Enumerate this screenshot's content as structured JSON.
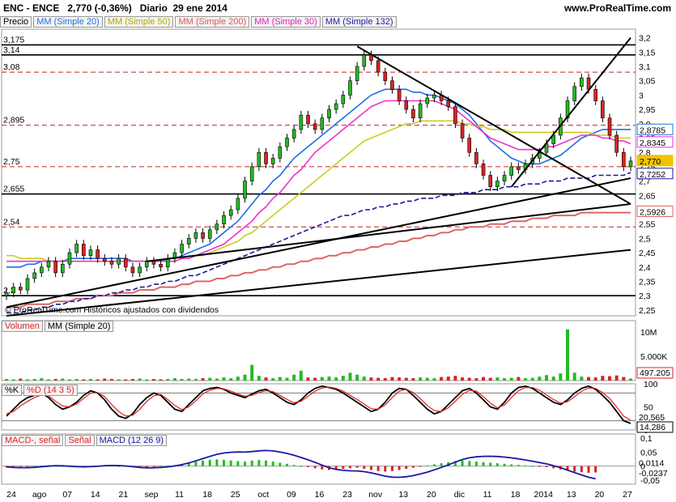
{
  "header": {
    "ticker": "ENC - ENCE",
    "last": "2,770 (-0,36%)",
    "period": "Diario",
    "date": "29 ene 2014",
    "brand": "www.ProRealTime.com"
  },
  "price_legend": {
    "price": "Precio",
    "mm20": "MM (Simple 20)",
    "mm50": "MM (Simple 50)",
    "mm200": "MM (Simple 200)",
    "mm30": "MM (Simple 30)",
    "mm132": "MM (Simple 132)"
  },
  "watermark": "© ProRealTime.com  Históricos ajustados con dividendos",
  "volume_legend": {
    "volume": "Volumen",
    "mm": "MM (Simple 20)"
  },
  "stoch_legend": {
    "k": "%K",
    "d": "%D (14 3 5)"
  },
  "macd_legend": {
    "macd": "MACD-, señal",
    "signal": "Señal",
    "params": "MACD (12 26 9)"
  },
  "colors": {
    "up": "#22bb22",
    "down": "#dd2222",
    "mm20": "#1f6fe0",
    "mm50": "#cccc22",
    "mm200": "#dd6666",
    "mm30": "#ee33cc",
    "mm132": "#1a1aa0",
    "current_label_bg": "#f2c200"
  },
  "chart_data": [
    {
      "type": "candlestick",
      "title": "ENC - ENCE",
      "ylim": [
        2.23,
        3.23
      ],
      "y_ticks": [
        "3,2",
        "3,15",
        "3,1",
        "3,05",
        "3",
        "2,95",
        "2,9",
        "2,85",
        "2,8",
        "2,75",
        "2,7",
        "2,65",
        "2,6",
        "2,55",
        "2,5",
        "2,45",
        "2,4",
        "2,35",
        "2,3",
        "2,25"
      ],
      "x_ticks": [
        "24",
        "ago",
        "07",
        "14",
        "21",
        "sep",
        "11",
        "18",
        "25",
        "oct",
        "09",
        "16",
        "23",
        "nov",
        "13",
        "20",
        "dic",
        "11",
        "18",
        "2014",
        "13",
        "20",
        "27"
      ],
      "horizontal_levels": [
        {
          "label": "3,175",
          "value": 3.175,
          "style": "solid"
        },
        {
          "label": "3,14",
          "value": 3.14,
          "style": "solid"
        },
        {
          "label": "3,08",
          "value": 3.08,
          "style": "dashed"
        },
        {
          "label": "2,895",
          "value": 2.895,
          "style": "dashed"
        },
        {
          "label": "2,75",
          "value": 2.75,
          "style": "dashed"
        },
        {
          "label": "2,655",
          "value": 2.655,
          "style": "solid"
        },
        {
          "label": "2,54",
          "value": 2.54,
          "style": "dashed"
        },
        {
          "label": "2,3",
          "value": 2.3,
          "style": "solid"
        }
      ],
      "right_labels": [
        {
          "text": "2,8785",
          "value": 2.879,
          "color": "#1f6fe0"
        },
        {
          "text": "2,8345",
          "value": 2.835,
          "color": "#ee33cc"
        },
        {
          "text": "2,770",
          "value": 2.77,
          "color": "#f2c200"
        },
        {
          "text": "2,7252",
          "value": 2.725,
          "color": "#1a1aa0"
        },
        {
          "text": "2,5926",
          "value": 2.593,
          "color": "#dd6666"
        }
      ],
      "close": [
        2.31,
        2.33,
        2.32,
        2.36,
        2.38,
        2.4,
        2.42,
        2.38,
        2.41,
        2.45,
        2.48,
        2.44,
        2.46,
        2.43,
        2.42,
        2.41,
        2.43,
        2.4,
        2.38,
        2.4,
        2.42,
        2.41,
        2.4,
        2.43,
        2.45,
        2.48,
        2.5,
        2.52,
        2.5,
        2.53,
        2.55,
        2.58,
        2.6,
        2.64,
        2.7,
        2.75,
        2.8,
        2.76,
        2.78,
        2.82,
        2.85,
        2.88,
        2.93,
        2.9,
        2.88,
        2.92,
        2.95,
        2.97,
        3.0,
        3.05,
        3.1,
        3.14,
        3.12,
        3.08,
        3.05,
        3.02,
        2.98,
        2.95,
        2.92,
        2.97,
        2.99,
        3.0,
        2.98,
        2.96,
        2.9,
        2.85,
        2.8,
        2.76,
        2.72,
        2.68,
        2.7,
        2.72,
        2.75,
        2.74,
        2.76,
        2.78,
        2.8,
        2.83,
        2.86,
        2.92,
        2.98,
        3.03,
        3.06,
        3.02,
        2.98,
        2.92,
        2.86,
        2.8,
        2.75,
        2.77
      ],
      "series": [
        {
          "name": "MM (Simple 20)",
          "values": [
            2.4,
            2.4,
            2.4,
            2.41,
            2.41,
            2.42,
            2.42,
            2.42,
            2.42,
            2.43,
            2.43,
            2.43,
            2.43,
            2.43,
            2.43,
            2.43,
            2.43,
            2.43,
            2.42,
            2.42,
            2.42,
            2.42,
            2.42,
            2.43,
            2.43,
            2.44,
            2.45,
            2.46,
            2.47,
            2.48,
            2.5,
            2.52,
            2.54,
            2.56,
            2.59,
            2.62,
            2.65,
            2.67,
            2.7,
            2.72,
            2.75,
            2.78,
            2.8,
            2.82,
            2.84,
            2.86,
            2.88,
            2.9,
            2.92,
            2.94,
            2.96,
            2.98,
            3.0,
            3.01,
            3.02,
            3.02,
            3.02,
            3.02,
            3.01,
            3.01,
            3.0,
            3.0,
            2.99,
            2.98,
            2.97,
            2.95,
            2.93,
            2.9,
            2.87,
            2.84,
            2.82,
            2.8,
            2.78,
            2.77,
            2.76,
            2.76,
            2.76,
            2.77,
            2.78,
            2.79,
            2.81,
            2.83,
            2.85,
            2.86,
            2.87,
            2.88,
            2.88,
            2.88,
            2.88,
            2.88
          ]
        },
        {
          "name": "MM (Simple 50)",
          "values": [
            2.44,
            2.44,
            2.43,
            2.43,
            2.43,
            2.43,
            2.42,
            2.42,
            2.42,
            2.42,
            2.42,
            2.42,
            2.42,
            2.42,
            2.42,
            2.42,
            2.42,
            2.42,
            2.42,
            2.42,
            2.42,
            2.42,
            2.42,
            2.42,
            2.42,
            2.43,
            2.43,
            2.44,
            2.44,
            2.45,
            2.46,
            2.47,
            2.48,
            2.49,
            2.51,
            2.52,
            2.54,
            2.56,
            2.58,
            2.6,
            2.62,
            2.64,
            2.66,
            2.68,
            2.7,
            2.72,
            2.74,
            2.76,
            2.78,
            2.8,
            2.82,
            2.84,
            2.85,
            2.86,
            2.87,
            2.88,
            2.89,
            2.9,
            2.9,
            2.91,
            2.91,
            2.91,
            2.91,
            2.91,
            2.91,
            2.9,
            2.9,
            2.89,
            2.89,
            2.88,
            2.88,
            2.88,
            2.87,
            2.87,
            2.87,
            2.87,
            2.87,
            2.87,
            2.87,
            2.87,
            2.87,
            2.87,
            2.87,
            2.87,
            2.86,
            2.86,
            2.86,
            2.85,
            2.85,
            2.85
          ]
        },
        {
          "name": "MM (Simple 200)",
          "values": [
            2.26,
            2.26,
            2.26,
            2.27,
            2.27,
            2.27,
            2.27,
            2.28,
            2.28,
            2.28,
            2.29,
            2.29,
            2.29,
            2.3,
            2.3,
            2.3,
            2.31,
            2.31,
            2.31,
            2.32,
            2.32,
            2.32,
            2.33,
            2.33,
            2.33,
            2.34,
            2.34,
            2.35,
            2.35,
            2.35,
            2.36,
            2.36,
            2.37,
            2.37,
            2.38,
            2.38,
            2.39,
            2.39,
            2.4,
            2.4,
            2.41,
            2.41,
            2.42,
            2.42,
            2.43,
            2.43,
            2.44,
            2.44,
            2.45,
            2.45,
            2.46,
            2.46,
            2.47,
            2.47,
            2.48,
            2.48,
            2.49,
            2.49,
            2.5,
            2.5,
            2.51,
            2.51,
            2.52,
            2.52,
            2.53,
            2.53,
            2.54,
            2.54,
            2.54,
            2.55,
            2.55,
            2.55,
            2.56,
            2.56,
            2.56,
            2.57,
            2.57,
            2.57,
            2.58,
            2.58,
            2.58,
            2.58,
            2.59,
            2.59,
            2.59,
            2.59,
            2.59,
            2.59,
            2.59,
            2.59
          ]
        },
        {
          "name": "MM (Simple 30)",
          "values": [
            2.42,
            2.42,
            2.42,
            2.42,
            2.42,
            2.42,
            2.42,
            2.42,
            2.42,
            2.42,
            2.42,
            2.42,
            2.42,
            2.42,
            2.42,
            2.42,
            2.42,
            2.42,
            2.42,
            2.42,
            2.42,
            2.42,
            2.42,
            2.42,
            2.42,
            2.43,
            2.43,
            2.44,
            2.45,
            2.46,
            2.47,
            2.48,
            2.5,
            2.52,
            2.54,
            2.56,
            2.59,
            2.61,
            2.64,
            2.66,
            2.69,
            2.72,
            2.74,
            2.77,
            2.8,
            2.82,
            2.84,
            2.86,
            2.88,
            2.9,
            2.92,
            2.94,
            2.96,
            2.97,
            2.98,
            2.98,
            2.98,
            2.98,
            2.98,
            2.98,
            2.98,
            2.98,
            2.97,
            2.96,
            2.95,
            2.93,
            2.91,
            2.89,
            2.87,
            2.85,
            2.84,
            2.83,
            2.82,
            2.81,
            2.81,
            2.81,
            2.81,
            2.82,
            2.82,
            2.83,
            2.84,
            2.85,
            2.86,
            2.86,
            2.86,
            2.85,
            2.85,
            2.84,
            2.84,
            2.83
          ]
        },
        {
          "name": "MM (Simple 132)",
          "values": [
            2.24,
            2.24,
            2.24,
            2.25,
            2.25,
            2.26,
            2.26,
            2.27,
            2.27,
            2.28,
            2.28,
            2.29,
            2.29,
            2.3,
            2.3,
            2.31,
            2.31,
            2.32,
            2.32,
            2.33,
            2.33,
            2.34,
            2.34,
            2.35,
            2.35,
            2.36,
            2.37,
            2.37,
            2.38,
            2.39,
            2.4,
            2.41,
            2.42,
            2.43,
            2.44,
            2.45,
            2.46,
            2.47,
            2.48,
            2.49,
            2.5,
            2.51,
            2.52,
            2.53,
            2.54,
            2.55,
            2.56,
            2.57,
            2.58,
            2.58,
            2.59,
            2.6,
            2.6,
            2.61,
            2.61,
            2.62,
            2.62,
            2.63,
            2.63,
            2.64,
            2.64,
            2.64,
            2.65,
            2.65,
            2.65,
            2.66,
            2.66,
            2.66,
            2.67,
            2.67,
            2.67,
            2.68,
            2.68,
            2.68,
            2.69,
            2.69,
            2.69,
            2.7,
            2.7,
            2.7,
            2.71,
            2.71,
            2.71,
            2.71,
            2.72,
            2.72,
            2.72,
            2.72,
            2.72,
            2.73
          ]
        }
      ]
    },
    {
      "type": "bar",
      "title": "Volumen",
      "y_ticks": [
        "10M",
        "5.000K"
      ],
      "current_label": "497.205",
      "values": [
        0.4,
        0.3,
        0.5,
        0.3,
        0.4,
        0.6,
        0.3,
        0.4,
        0.5,
        0.3,
        0.4,
        0.3,
        0.4,
        0.3,
        0.5,
        0.4,
        0.3,
        0.3,
        0.4,
        0.5,
        0.3,
        0.4,
        0.3,
        0.4,
        0.6,
        0.4,
        0.5,
        0.4,
        0.6,
        0.7,
        0.5,
        0.8,
        0.6,
        1.0,
        1.5,
        4.0,
        1.2,
        0.8,
        0.6,
        0.9,
        0.7,
        1.5,
        2.5,
        0.8,
        0.7,
        0.9,
        1.0,
        0.8,
        1.2,
        2.0,
        1.5,
        1.0,
        0.8,
        0.7,
        0.6,
        0.9,
        0.8,
        0.7,
        0.6,
        0.8,
        0.7,
        0.6,
        0.9,
        1.0,
        1.2,
        0.8,
        0.7,
        0.6,
        0.9,
        0.7,
        0.8,
        0.6,
        0.7,
        0.9,
        0.6,
        0.7,
        1.0,
        1.4,
        1.0,
        1.8,
        13.0,
        2.0,
        1.0,
        0.9,
        0.8,
        1.2,
        1.1,
        1.3,
        0.9,
        0.5
      ]
    },
    {
      "type": "line",
      "title": "%K %D (14 3 5)",
      "y_ticks": [
        "100",
        "50",
        "0"
      ],
      "current_labels": [
        "20,565",
        "14,286"
      ],
      "series": [
        {
          "name": "%K",
          "values": [
            30,
            45,
            60,
            70,
            75,
            80,
            70,
            55,
            45,
            50,
            60,
            75,
            85,
            80,
            65,
            45,
            30,
            25,
            35,
            55,
            70,
            80,
            75,
            60,
            45,
            40,
            55,
            70,
            85,
            90,
            92,
            88,
            80,
            75,
            70,
            78,
            85,
            88,
            80,
            70,
            60,
            55,
            65,
            80,
            90,
            95,
            92,
            88,
            80,
            70,
            60,
            50,
            40,
            45,
            60,
            80,
            90,
            88,
            75,
            60,
            45,
            35,
            40,
            55,
            70,
            85,
            90,
            80,
            65,
            50,
            45,
            60,
            80,
            92,
            95,
            90,
            80,
            70,
            60,
            55,
            65,
            80,
            90,
            95,
            88,
            75,
            60,
            40,
            20,
            14
          ]
        },
        {
          "name": "%D",
          "values": [
            35,
            40,
            52,
            62,
            70,
            76,
            74,
            62,
            52,
            50,
            56,
            68,
            80,
            81,
            72,
            55,
            40,
            30,
            32,
            45,
            62,
            74,
            77,
            66,
            53,
            44,
            50,
            63,
            78,
            86,
            90,
            89,
            84,
            78,
            73,
            75,
            81,
            85,
            83,
            75,
            66,
            59,
            62,
            73,
            84,
            91,
            93,
            90,
            84,
            75,
            66,
            56,
            46,
            45,
            54,
            70,
            84,
            88,
            81,
            68,
            53,
            42,
            40,
            48,
            62,
            77,
            86,
            84,
            72,
            58,
            48,
            54,
            70,
            85,
            92,
            92,
            86,
            76,
            66,
            58,
            61,
            72,
            84,
            91,
            90,
            81,
            68,
            50,
            30,
            21
          ]
        }
      ]
    },
    {
      "type": "bar",
      "title": "MACD (12 26 9)",
      "y_ticks": [
        "0,1",
        "0,05",
        "0",
        "-0,05"
      ],
      "current_labels": [
        "0,0114",
        "-0,0237"
      ],
      "values": [
        -0.005,
        -0.004,
        -0.003,
        -0.002,
        0.0,
        0.002,
        0.003,
        0.002,
        0.0,
        -0.002,
        -0.003,
        -0.002,
        0.0,
        0.002,
        0.003,
        0.002,
        0.0,
        -0.002,
        -0.004,
        -0.005,
        -0.004,
        -0.002,
        0.0,
        0.002,
        0.004,
        0.008,
        0.012,
        0.016,
        0.02,
        0.022,
        0.024,
        0.022,
        0.02,
        0.018,
        0.016,
        0.02,
        0.022,
        0.02,
        0.016,
        0.012,
        0.008,
        0.004,
        0.0,
        -0.004,
        -0.008,
        -0.012,
        -0.014,
        -0.012,
        -0.01,
        -0.008,
        -0.006,
        -0.01,
        -0.014,
        -0.018,
        -0.02,
        -0.018,
        -0.014,
        -0.01,
        -0.006,
        -0.002,
        0.002,
        0.006,
        0.01,
        0.014,
        0.018,
        0.02,
        0.018,
        0.016,
        0.014,
        0.012,
        0.01,
        0.008,
        0.006,
        0.004,
        0.002,
        0.0,
        -0.002,
        -0.004,
        -0.008,
        -0.012,
        -0.016,
        -0.02,
        -0.022,
        -0.024,
        -0.023
      ]
    }
  ]
}
